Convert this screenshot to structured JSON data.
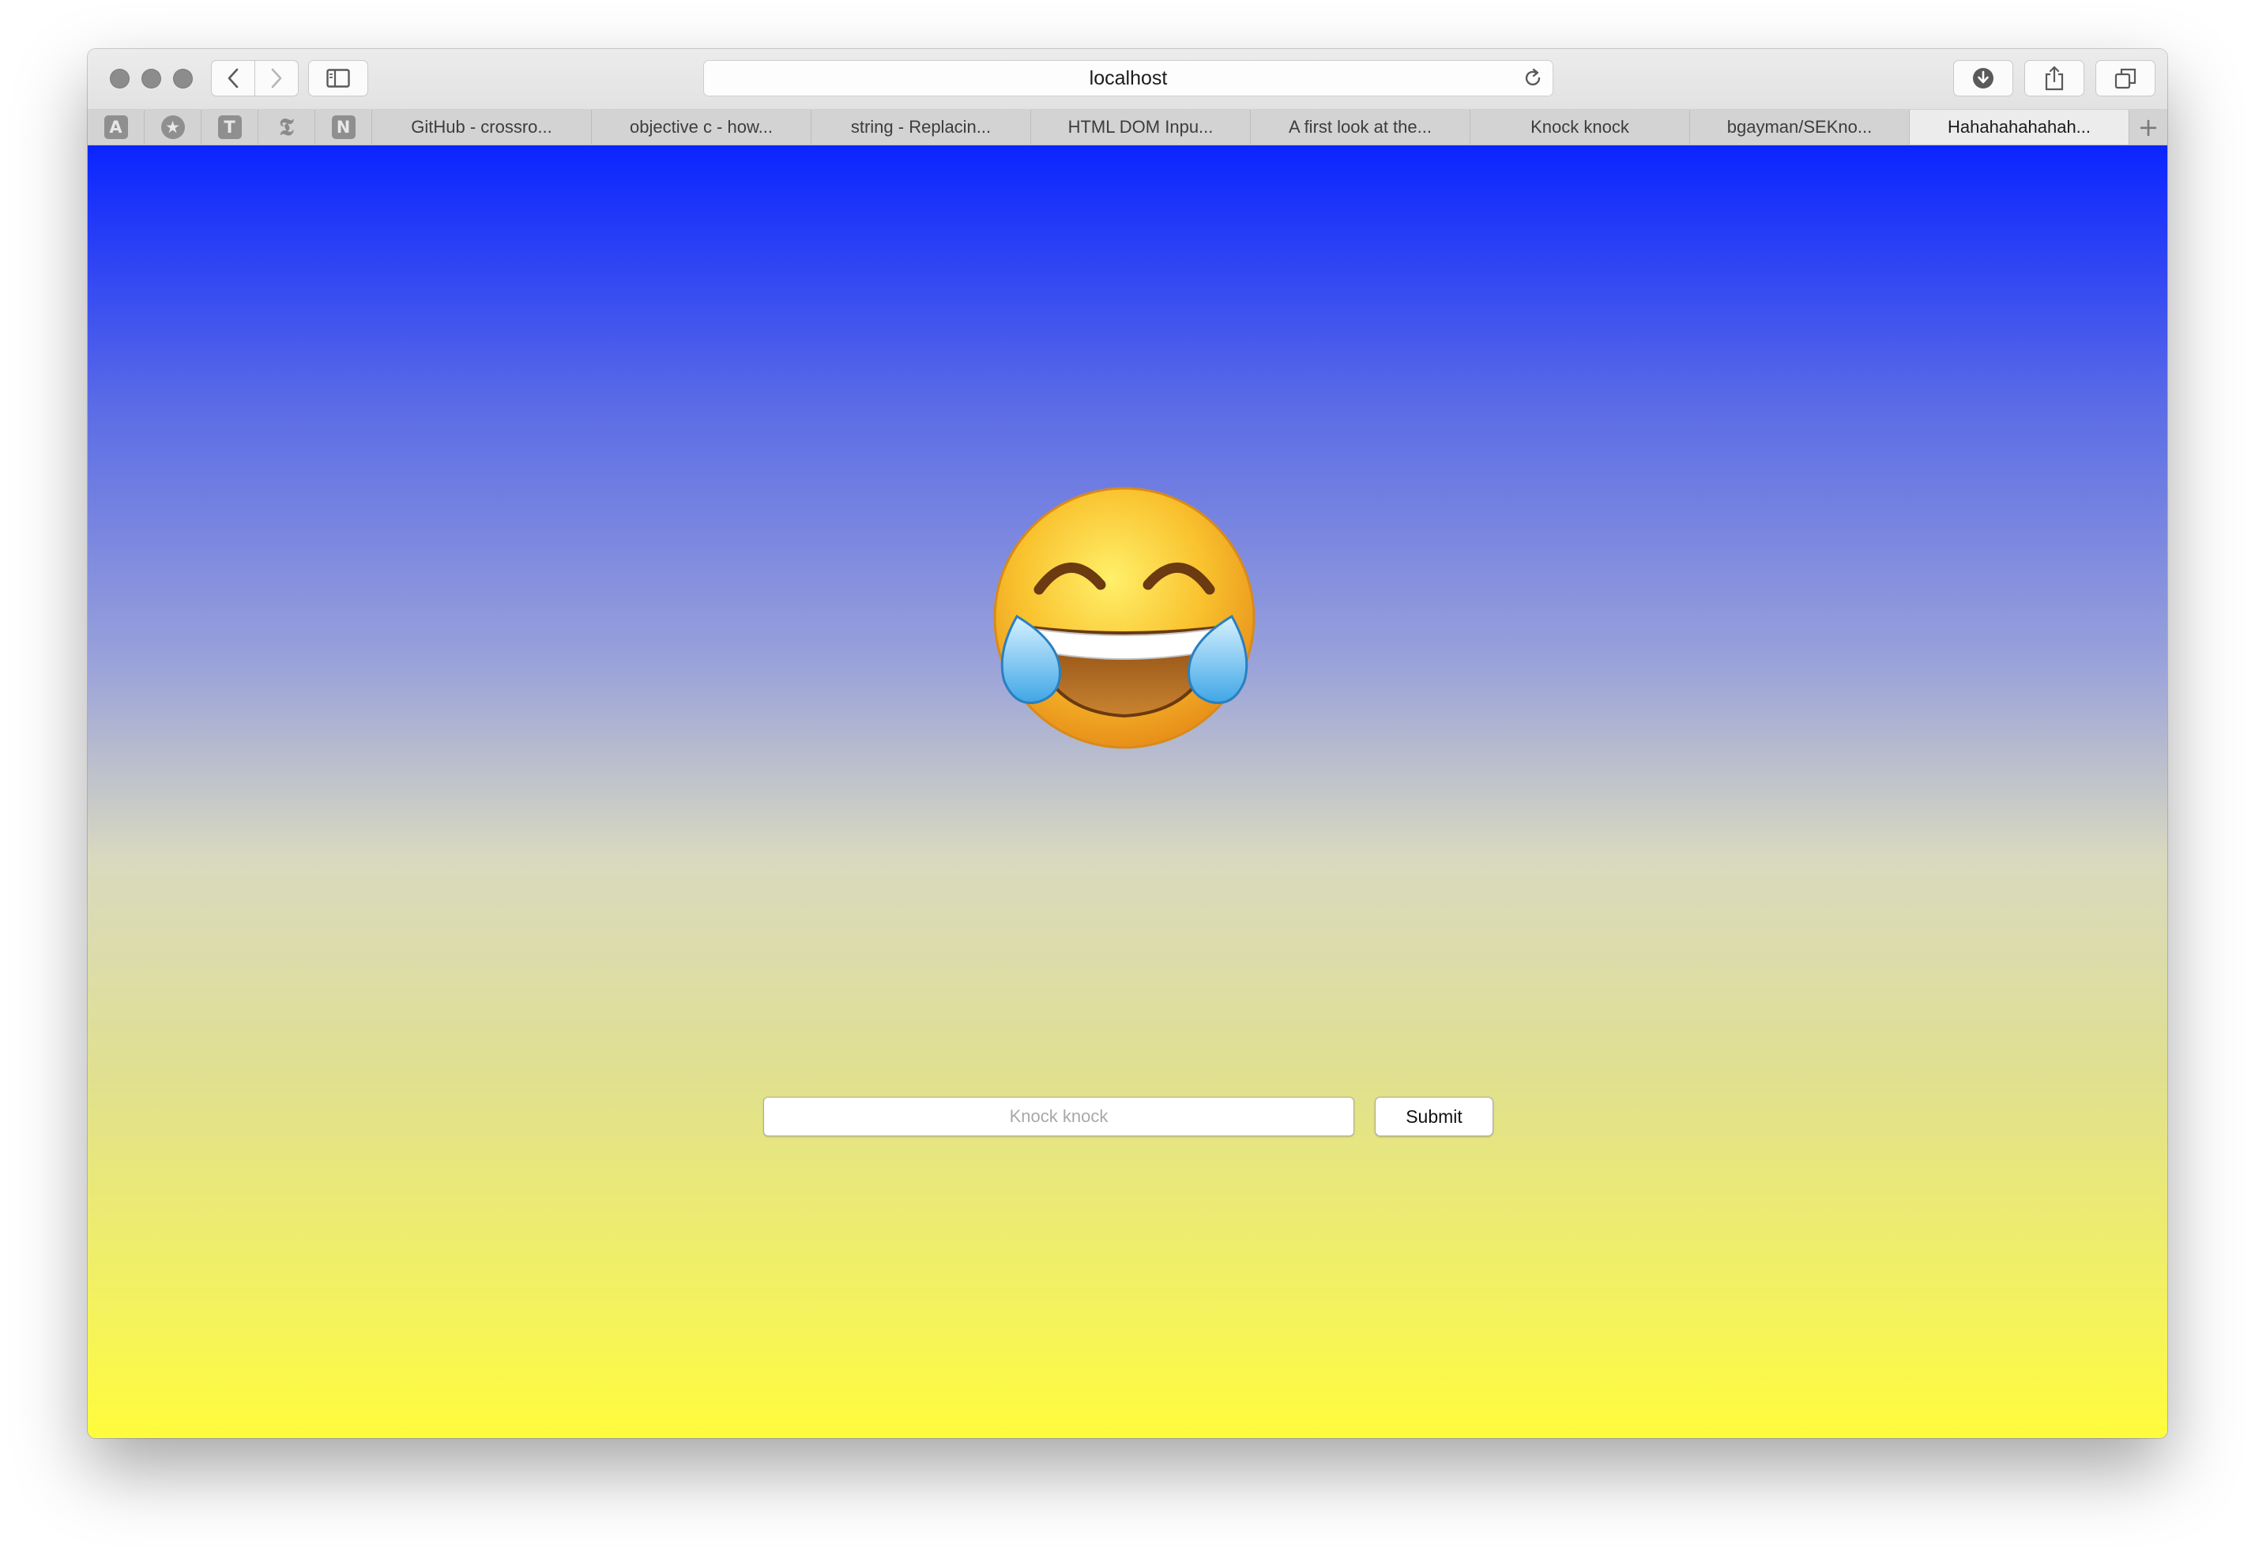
{
  "browser": {
    "address_bar": {
      "url": "localhost"
    },
    "pinned_tabs": [
      {
        "glyph": "A",
        "icon": "letter-a-icon"
      },
      {
        "glyph": "★",
        "icon": "star-badge-icon"
      },
      {
        "glyph": "T",
        "icon": "letter-t-icon"
      },
      {
        "glyph": "𝕿",
        "icon": "nyt-logo-icon"
      },
      {
        "glyph": "N",
        "icon": "letter-n-icon"
      }
    ],
    "tabs": [
      {
        "title": "GitHub - crossro..."
      },
      {
        "title": "objective c - how..."
      },
      {
        "title": "string - Replacin..."
      },
      {
        "title": "HTML DOM Inpu..."
      },
      {
        "title": "A first look at the..."
      },
      {
        "title": "Knock knock"
      },
      {
        "title": "bgayman/SEKno..."
      },
      {
        "title": "Hahahahahahah...",
        "active": true
      }
    ],
    "new_tab_glyph": "+"
  },
  "page": {
    "emoji": "face-with-tears-of-joy",
    "form": {
      "input_placeholder": "Knock knock",
      "input_value": "",
      "submit_label": "Submit"
    },
    "gradient_colors": [
      "#0a24ff",
      "#9aa2da",
      "#d9d9c0",
      "#fffc3c"
    ]
  }
}
